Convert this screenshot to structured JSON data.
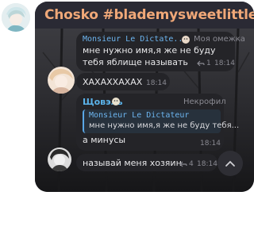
{
  "chat": {
    "title": "Chosko #blademysweetlittleboy"
  },
  "messages": [
    {
      "reply_sender": "Monsieur Le Dictate...",
      "reply_label": "Моя омежка",
      "text_line1": "мне нужно имя,я же не буду",
      "text_line2": "тебя яблище называть",
      "reply_count": "1",
      "time": "18:14"
    },
    {
      "text": "ХАХАХХАХАХ",
      "time": "18:14"
    },
    {
      "sender": "Щовэль",
      "sender_label": "Некрофил",
      "quote_name": "Monsieur Le Dictateur",
      "quote_text": "мне нужно имя,я же не буду тебя...",
      "text": "а минусы",
      "time": "18:14"
    },
    {
      "text": "называй меня хозяин",
      "reply_count": "4",
      "time": "18:14"
    }
  ],
  "icons": {
    "reply": "reply-icon",
    "scroll_down": "chevron-up-icon"
  },
  "colors": {
    "title": "#f0a878",
    "reply_name": "#6cb4ee",
    "sender_name": "#5bb3ea",
    "bubble": "#242428"
  }
}
